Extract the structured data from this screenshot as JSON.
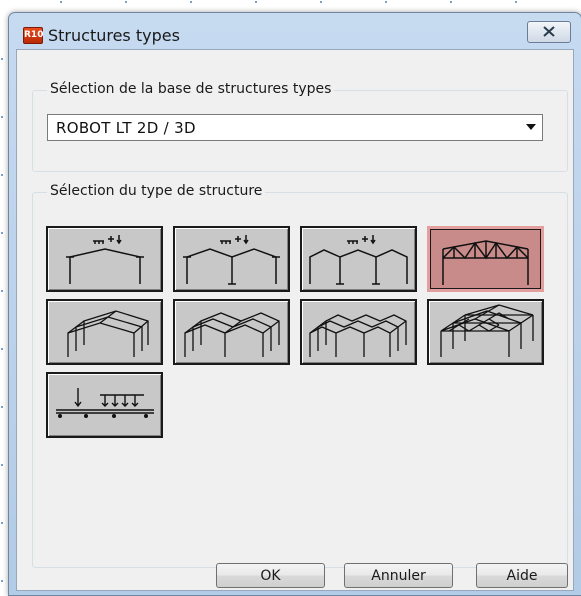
{
  "window": {
    "title": "Structures types",
    "icon_text": "R10"
  },
  "database_group": {
    "label": "Sélection de la base de structures types",
    "selected_value": "ROBOT LT 2D / 3D"
  },
  "structure_group": {
    "label": "Sélection du type de structure",
    "tiles": [
      {
        "icon": "portal-frame-2d-icon",
        "selected": false
      },
      {
        "icon": "portal-frame-2d-two-span-icon",
        "selected": false
      },
      {
        "icon": "portal-frame-2d-three-span-icon",
        "selected": false
      },
      {
        "icon": "truss-frame-2d-icon",
        "selected": true
      },
      {
        "icon": "portal-frame-3d-icon",
        "selected": false
      },
      {
        "icon": "portal-frame-3d-two-span-icon",
        "selected": false
      },
      {
        "icon": "portal-frame-3d-three-span-icon",
        "selected": false
      },
      {
        "icon": "truss-frame-3d-icon",
        "selected": false
      },
      {
        "icon": "continuous-beam-icon",
        "selected": false
      }
    ]
  },
  "buttons": {
    "ok": "OK",
    "cancel": "Annuler",
    "help": "Aide"
  },
  "colors": {
    "selected_tile": "#c98a8a",
    "selected_border": "#e39e9e",
    "tile_background": "#c8c8c8"
  }
}
